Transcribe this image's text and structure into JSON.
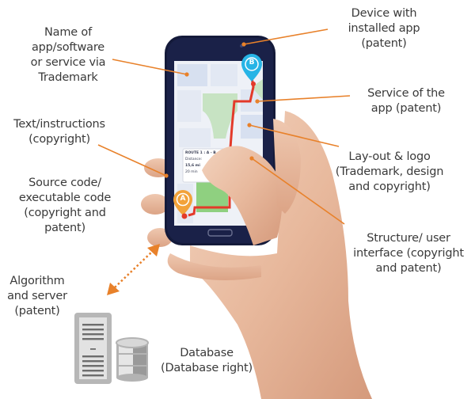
{
  "diagram": {
    "accent_color": "#e8812a",
    "labels": [
      {
        "id": "name-of-app",
        "lines": [
          "Name of",
          "app/software",
          "or service via",
          "Trademark"
        ]
      },
      {
        "id": "text-instructions",
        "lines": [
          "Text/instructions",
          "(copyright)"
        ]
      },
      {
        "id": "source-code",
        "lines": [
          "Source code/",
          "executable code",
          "(copyright and",
          "patent)"
        ]
      },
      {
        "id": "algorithm-server",
        "lines": [
          "Algorithm",
          "and server",
          "(patent)"
        ]
      },
      {
        "id": "database",
        "lines": [
          "Database",
          "(Database right)"
        ]
      },
      {
        "id": "device",
        "lines": [
          "Device with",
          "installed app",
          "(patent)"
        ]
      },
      {
        "id": "service",
        "lines": [
          "Service of the",
          "app (patent)"
        ]
      },
      {
        "id": "layout-logo",
        "lines": [
          "Lay-out & logo",
          "(Trademark, design",
          "and copyright)"
        ]
      },
      {
        "id": "structure-ui",
        "lines": [
          "Structure/ user",
          "interface (copyright",
          "and patent)"
        ]
      }
    ],
    "phone_screen": {
      "map_pin_start": "A",
      "map_pin_end": "B",
      "route_card": [
        "ROUTE 1 : A - B",
        "Distance:",
        "15,6 mi",
        "20 min"
      ]
    },
    "icons": [
      "server-icon",
      "database-icon",
      "double-arrow-icon",
      "smartphone-icon",
      "hand-icon"
    ]
  }
}
